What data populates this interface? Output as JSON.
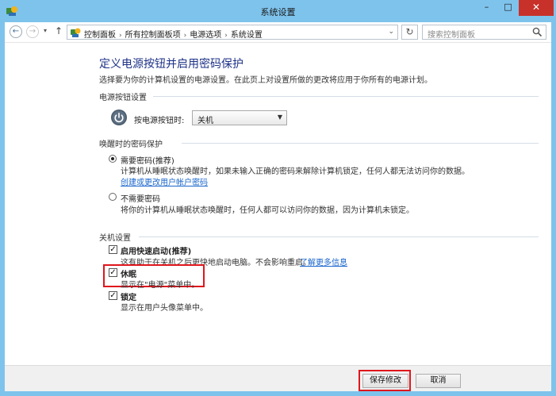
{
  "window": {
    "title": "系统设置",
    "controls": {
      "minimize": "–",
      "maximize": "□",
      "close": "✕"
    }
  },
  "nav": {
    "back": "←",
    "forward": "→",
    "recent_dropdown": "▾",
    "up": "↑",
    "breadcrumbs": [
      "控制面板",
      "所有控制面板项",
      "电源选项",
      "系统设置"
    ],
    "breadcrumb_sep": "›",
    "address_dropdown": "⌄",
    "refresh": "↻",
    "search_placeholder": "搜索控制面板"
  },
  "page": {
    "title": "定义电源按钮并启用密码保护",
    "description": "选择要为你的计算机设置的电源设置。在此页上对设置所做的更改将应用于你所有的电源计划。"
  },
  "power_section": {
    "heading": "电源按钮设置",
    "label": "按电源按钮时:",
    "selected": "关机"
  },
  "password_section": {
    "heading": "唤醒时的密码保护",
    "require": {
      "label": "需要密码(推荐)",
      "selected": true,
      "desc": "计算机从睡眠状态唤醒时，如果未输入正确的密码来解除计算机锁定，任何人都无法访问你的数据。",
      "link": "创建或更改用户帐户密码"
    },
    "no_require": {
      "label": "不需要密码",
      "selected": false,
      "desc": "将你的计算机从睡眠状态唤醒时，任何人都可以访问你的数据，因为计算机未锁定。"
    }
  },
  "shutdown_section": {
    "heading": "关机设置",
    "fast_startup": {
      "label": "启用快速启动(推荐)",
      "checked": true,
      "desc": "这有助于在关机之后更快地启动电脑。不会影响重启。",
      "link": "了解更多信息"
    },
    "hibernate": {
      "label": "休眠",
      "checked": true,
      "desc": "显示在\"电源\"菜单中。"
    },
    "lock": {
      "label": "锁定",
      "checked": true,
      "desc": "显示在用户头像菜单中。"
    },
    "check_glyph": "✓"
  },
  "footer": {
    "save": "保存修改",
    "cancel": "取消"
  },
  "colors": {
    "titlebar": "#7ec3ec",
    "heading": "#1e3287",
    "link": "#1a66cc",
    "highlight": "#e0161c",
    "close": "#c7312a"
  }
}
